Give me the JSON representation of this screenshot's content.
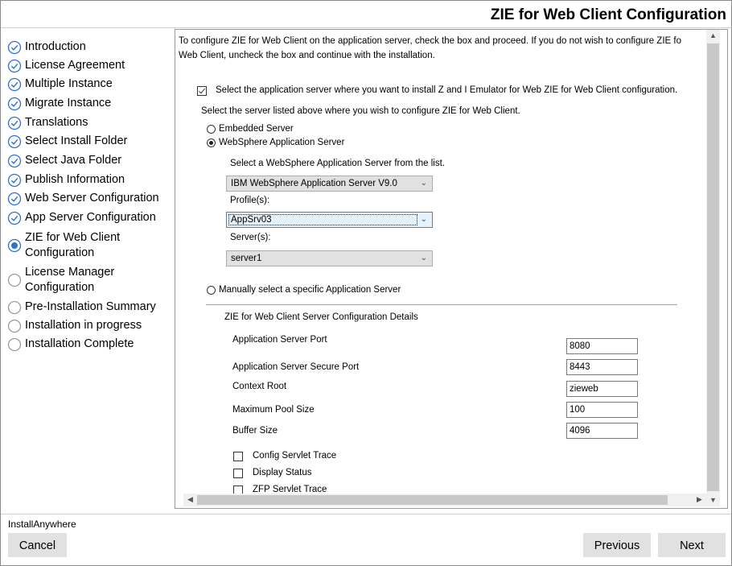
{
  "header": {
    "title": "ZIE for Web Client Configuration"
  },
  "steps": [
    {
      "label": "Introduction",
      "status": "done"
    },
    {
      "label": "License Agreement",
      "status": "done"
    },
    {
      "label": "Multiple Instance",
      "status": "done"
    },
    {
      "label": "Migrate Instance",
      "status": "done"
    },
    {
      "label": "Translations",
      "status": "done"
    },
    {
      "label": "Select Install Folder",
      "status": "done"
    },
    {
      "label": "Select Java Folder",
      "status": "done"
    },
    {
      "label": "Publish Information",
      "status": "done"
    },
    {
      "label": "Web Server Configuration",
      "status": "done"
    },
    {
      "label": "App Server Configuration",
      "status": "done"
    },
    {
      "label_line1": "ZIE for Web Client",
      "label_line2": "Configuration",
      "status": "current"
    },
    {
      "label_line1": "License Manager",
      "label_line2": "Configuration",
      "status": "pending"
    },
    {
      "label": "Pre-Installation Summary",
      "status": "pending"
    },
    {
      "label": "Installation in progress",
      "status": "pending"
    },
    {
      "label": "Installation Complete",
      "status": "pending"
    }
  ],
  "content": {
    "intro_line1": "To configure ZIE for Web Client on the application server, check the box and proceed. If you do not wish to configure ZIE fo",
    "intro_line2": "Web Client, uncheck the box and continue with the installation.",
    "install_checkbox_label": "Select the application server where you want to install Z and I Emulator for Web ZIE for Web Client configuration.",
    "install_checkbox_checked": true,
    "server_prompt": "Select the server listed above where you wish to configure ZIE for Web Client.",
    "radio_embedded": "Embedded Server",
    "radio_websphere": "WebSphere Application Server",
    "selected_radio": "websphere",
    "was_prompt": "Select a WebSphere Application Server from the list.",
    "was_select_value": "IBM WebSphere Application Server V9.0",
    "profiles_label": "Profile(s):",
    "profile_value": "AppSrv03",
    "servers_label": "Server(s):",
    "server_value": "server1",
    "radio_manual": "Manually select a specific Application Server",
    "details_heading": "ZIE for Web Client Server Configuration Details",
    "fields": [
      {
        "label": "Application Server Port",
        "value": "8080"
      },
      {
        "label": "Application Server Secure Port",
        "value": "8443"
      },
      {
        "label": "Context Root",
        "value": "zieweb"
      },
      {
        "label": "Maximum Pool Size",
        "value": "100"
      },
      {
        "label": "Buffer Size",
        "value": "4096"
      }
    ],
    "options": [
      {
        "label": "Config Servlet Trace",
        "checked": false
      },
      {
        "label": "Display Status",
        "checked": false
      },
      {
        "label": "ZFP Servlet Trace",
        "checked": false
      }
    ]
  },
  "footer": {
    "brand": "InstallAnywhere",
    "cancel_label": "Cancel",
    "previous_label": "Previous",
    "next_label": "Next"
  },
  "colors": {
    "step_icon": "#2f6fcf",
    "pending_icon": "#9a9a9a"
  }
}
